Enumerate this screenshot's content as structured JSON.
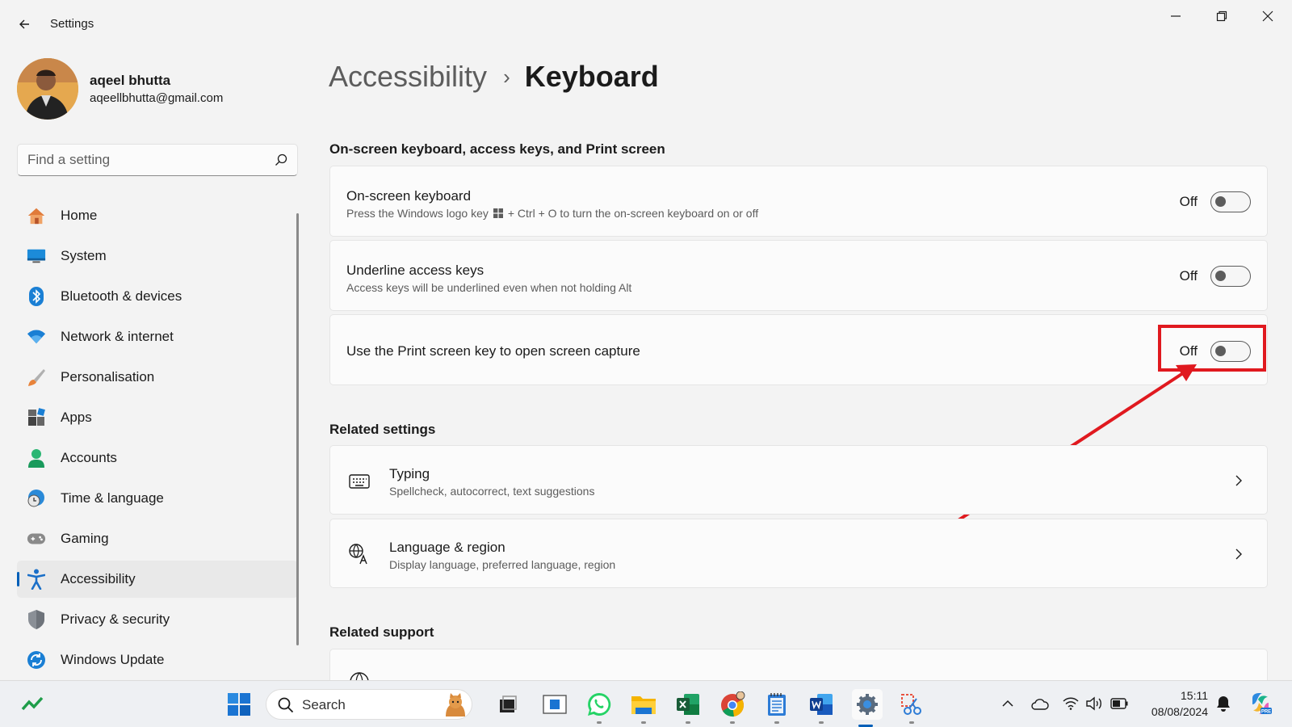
{
  "window": {
    "title": "Settings"
  },
  "profile": {
    "name": "aqeel bhutta",
    "email": "aqeellbhutta@gmail.com"
  },
  "search": {
    "placeholder": "Find a setting"
  },
  "nav": {
    "items": [
      {
        "label": "Home",
        "icon": "home-icon"
      },
      {
        "label": "System",
        "icon": "system-icon"
      },
      {
        "label": "Bluetooth & devices",
        "icon": "bluetooth-icon"
      },
      {
        "label": "Network & internet",
        "icon": "wifi-icon"
      },
      {
        "label": "Personalisation",
        "icon": "brush-icon"
      },
      {
        "label": "Apps",
        "icon": "apps-icon"
      },
      {
        "label": "Accounts",
        "icon": "person-icon"
      },
      {
        "label": "Time & language",
        "icon": "globe-clock-icon"
      },
      {
        "label": "Gaming",
        "icon": "gamepad-icon"
      },
      {
        "label": "Accessibility",
        "icon": "accessibility-icon",
        "active": true
      },
      {
        "label": "Privacy & security",
        "icon": "shield-icon"
      },
      {
        "label": "Windows Update",
        "icon": "update-icon"
      }
    ]
  },
  "breadcrumb": {
    "parent": "Accessibility",
    "separator": "›",
    "current": "Keyboard"
  },
  "sections": {
    "keyboard": {
      "title": "On-screen keyboard, access keys, and Print screen",
      "items": [
        {
          "title": "On-screen keyboard",
          "subtitle_pre": "Press the Windows logo key",
          "subtitle_post": "+ Ctrl + O to turn the on-screen keyboard on or off",
          "state": "Off"
        },
        {
          "title": "Underline access keys",
          "subtitle": "Access keys will be underlined even when not holding Alt",
          "state": "Off"
        },
        {
          "title": "Use the Print screen key to open screen capture",
          "state": "Off"
        }
      ]
    },
    "related_settings": {
      "title": "Related settings",
      "items": [
        {
          "title": "Typing",
          "subtitle": "Spellcheck, autocorrect, text suggestions",
          "icon": "keyboard-icon"
        },
        {
          "title": "Language & region",
          "subtitle": "Display language, preferred language, region",
          "icon": "language-icon"
        }
      ]
    },
    "related_support": {
      "title": "Related support"
    }
  },
  "taskbar": {
    "search_label": "Search",
    "time": "15:11",
    "date": "08/08/2024"
  },
  "colors": {
    "accent": "#005fb8",
    "annotation": "#e0191f"
  }
}
